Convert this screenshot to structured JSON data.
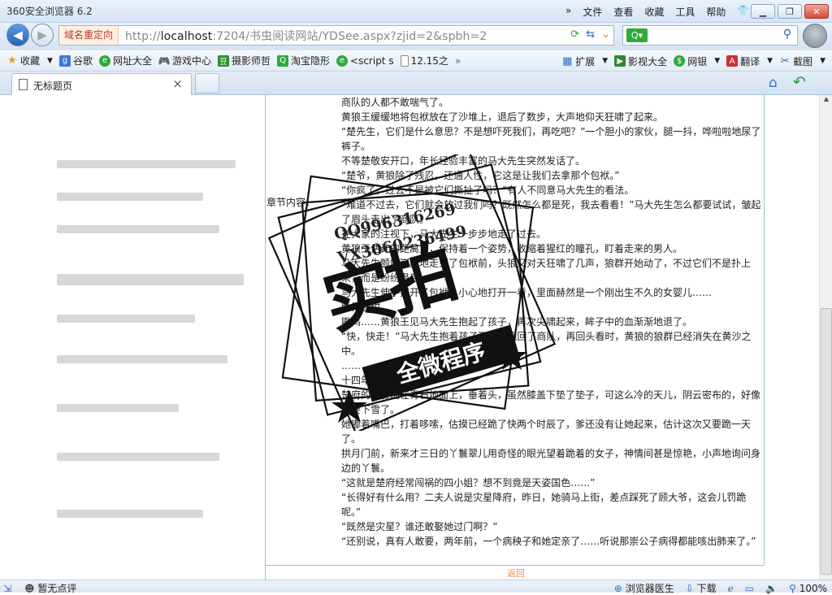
{
  "window": {
    "title": "360安全浏览器 6.2",
    "menu": [
      "文件",
      "查看",
      "收藏",
      "工具",
      "帮助"
    ],
    "menu_chevron": "»"
  },
  "addressbar": {
    "badge": "域名重定向",
    "url_prefix": "http://",
    "url_host": "localhost",
    "url_rest": ":7204/书虫阅读网站/YDSee.aspx?zjid=2&spbh=2"
  },
  "bookmarks": {
    "left": [
      {
        "label": "收藏",
        "icon": "star-icon",
        "color": "#e0a020",
        "dropdown": true
      },
      {
        "label": "谷歌",
        "icon": "google-icon",
        "color": "#3a78d8"
      },
      {
        "label": "网址大全",
        "icon": "site-nav-icon",
        "color": "#2eaa3a"
      },
      {
        "label": "游戏中心",
        "icon": "gamepad-icon",
        "color": "#666666"
      },
      {
        "label": "摄影师哲",
        "icon": "douban-icon",
        "color": "#2e8b2e"
      },
      {
        "label": "淘宝隐形",
        "icon": "search-green-icon",
        "color": "#2eaa3a"
      },
      {
        "label": "<script s",
        "icon": "site-nav-icon",
        "color": "#2eaa3a"
      },
      {
        "label": "12.15之",
        "icon": "page-icon",
        "color": "#888888"
      }
    ],
    "more": "»",
    "right": [
      {
        "label": "扩展",
        "icon": "grid-icon",
        "color": "#2e6fb8"
      },
      {
        "label": "影视大全",
        "icon": "play-icon",
        "color": "#2e8b2e"
      },
      {
        "label": "网银",
        "icon": "shield-icon",
        "color": "#2eaa3a"
      },
      {
        "label": "翻译",
        "icon": "translate-icon",
        "color": "#d03030"
      },
      {
        "label": "截图",
        "icon": "scissors-icon",
        "color": "#2e6fb8"
      }
    ]
  },
  "tabs": {
    "active_title": "无标题页",
    "close": "×"
  },
  "content": {
    "chapter_label": "章节内容：",
    "paragraphs": [
      {
        "text": "商队的人都不敢喘气了。",
        "indent": true
      },
      {
        "text": "黄狼王缓缓地将包袱放在了沙堆上，退后了数步，大声地仰天狂啸了起来。",
        "indent": true
      },
      {
        "text": "“楚先生，它们是什么意思？不是想吓死我们，再吃吧？”一个胆小的家伙，腿一抖，哗啦啦地尿了裤子。",
        "indent": true
      },
      {
        "text": "不等楚敬安开口，年长经验丰富的马大先生突然发话了。",
        "indent": true
      },
      {
        "text": "“楚爷，黄狼除了残忍，还通人性，它这是让我们去拿那个包袱。”",
        "indent": true
      },
      {
        "text": "“你疯了，过去不是被它们撕扯了吗？”有人不同意马大先生的看法。",
        "indent": true
      },
      {
        "text": "“难道不过去，它们就会放过我们吗？既然怎么都是死，我去看看！”马大先生怎么都要试试，皱起了眉头走出了商队。",
        "indent": true
      },
      {
        "text": "在大家的注视下，马大先生一步步地走了过去。",
        "indent": true
      },
      {
        "text": "黄狼王估计的距离里，保持着一个姿势，收缩着猩红的瞳孔，盯着走来的男人。",
        "indent": true
      },
      {
        "text": "马大先生颤颤巍巍地走到了包袱前，头狼又对天狂啸了几声，狼群开始动了，不过它们不是扑上来，而是纷纷退后。",
        "indent": true
      },
      {
        "text": "马大先生伸手揭开了包袱，小心地打开一看，里面赫然是一个刚出生不久的女婴儿……",
        "indent": true
      },
      {
        "text": "睡得香甜。",
        "indent": true
      },
      {
        "text": "嗷呜……黄狼王见马大先生抱起了孩子，再次尖啸起来，眸子中的血渐渐地退了。",
        "indent": true
      },
      {
        "text": "“快，快走！”马大先生抱着孩子飞快地跑回了商队，再回头看时，黄狼的狼群已经消失在黄沙之中。",
        "indent": true
      },
      {
        "text": "……",
        "indent": true
      },
      {
        "text": "十四年后。",
        "indent": true
      },
      {
        "text": "楚府的双膝跪在青石地面上，垂着头，虽然膝盖下垫了垫子，可这么冷的天儿，阴云密布的，好像又要下雪了。",
        "indent": true
      },
      {
        "text": "她嘟着嘴巴，打着哆嗦，估摸已经跪了快两个时辰了，爹还没有让她起来，估计这次又要跪一天了。",
        "indent": true
      },
      {
        "text": "拱月门前，新来才三日的丫鬟翠儿用奇怪的眼光望着跪着的女子，神情间甚是惊艳，小声地询问身边的丫鬟。",
        "indent": true
      },
      {
        "text": "“这就是楚府经常闯祸的四小姐？想不到竟是天姿国色……”",
        "indent": true
      },
      {
        "text": "“长得好有什么用？二夫人说是灾星降府，昨日，她骑马上街，差点踩死了顾大爷，这会儿罚跪呢。”",
        "indent": true
      },
      {
        "text": "“既然是灾星？谁还敢娶她过门啊？”",
        "indent": true
      },
      {
        "text": "“还别说，真有人敢要，两年前，一个病秧子和她定亲了……听说那崇公子病得都能咳出肺来了。”",
        "indent": true
      }
    ],
    "back_link": "返回"
  },
  "stamp": {
    "qq1": "QQ996316269",
    "qq2": "VX3060236499",
    "big": "实拍",
    "ribbon": "全微程序"
  },
  "statusbar": {
    "left_text": "暂无点评",
    "doctor": "浏览器医生",
    "download": "下载",
    "zoom": "100%"
  }
}
